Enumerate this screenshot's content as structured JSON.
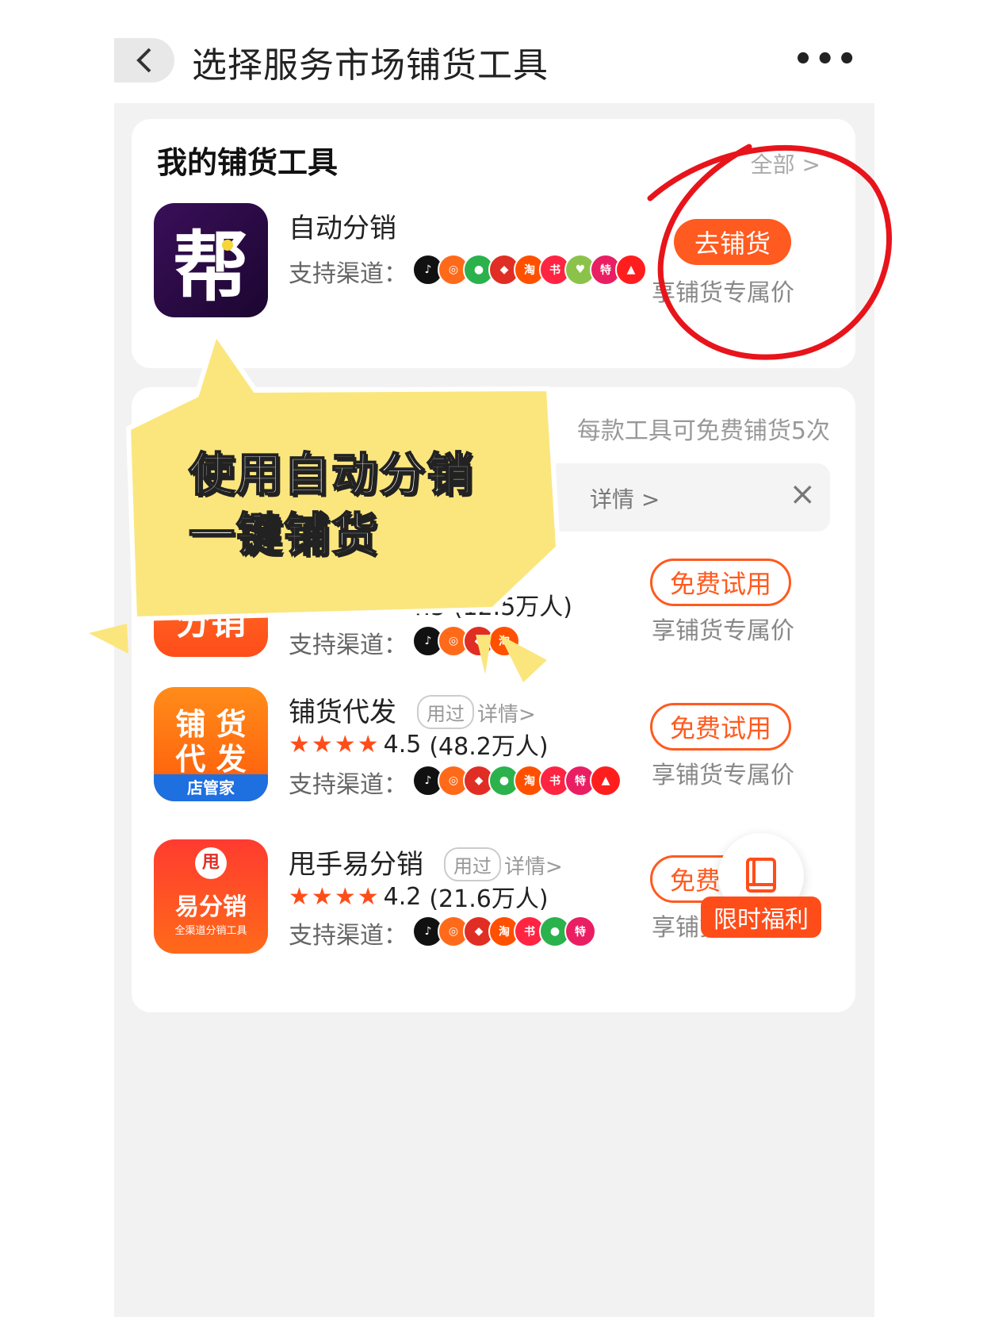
{
  "nav": {
    "back_icon": "chevron-left-icon",
    "title": "选择服务市场铺货工具",
    "more_icon": "ellipsis-icon",
    "more_glyph": "•••"
  },
  "my_tools": {
    "title": "我的铺货工具",
    "view_all": "全部 >",
    "app": {
      "name": "自动分销",
      "icon_glyph": "帮",
      "channels_label": "支持渠道：",
      "action": "去铺货",
      "price_note": "享铺货专属价"
    }
  },
  "market": {
    "notice": "每款工具可免费铺货5次",
    "tips_detail": "详情 >",
    "close_glyph": "×",
    "apps": [
      {
        "name": "分销",
        "rating_text": "4.5 (12.5万人)",
        "channels_label": "支持渠道：",
        "action": "免费试用",
        "price_note": "享铺货专属价"
      },
      {
        "name": "铺货代发",
        "used_tag": "用过",
        "detail": "详情>",
        "icon_line1": "铺 货",
        "icon_line2": "代 发",
        "icon_sub": "店管家",
        "stars": 4,
        "rating": "4.5",
        "raters": "(48.2万人)",
        "channels_label": "支持渠道：",
        "action": "免费试用",
        "price_note": "享铺货专属价"
      },
      {
        "name": "甩手易分销",
        "used_tag": "用过",
        "detail": "详情>",
        "icon_mark": "甩",
        "icon_line1": "易分销",
        "icon_sub": "全渠道分销工具",
        "stars": 4,
        "rating": "4.2",
        "raters": "(21.6万人)",
        "channels_label": "支持渠道：",
        "action": "免费试用",
        "price_note": "享铺货专属价"
      }
    ]
  },
  "float": {
    "icon": "book-icon",
    "badge": "限时福利"
  },
  "annotation": {
    "line1": "使用自动分销",
    "line2": "一键铺货"
  },
  "colors": {
    "accent": "#ff5a1f",
    "annotation_circle": "#e8141b",
    "bubble": "#fbe67e"
  }
}
